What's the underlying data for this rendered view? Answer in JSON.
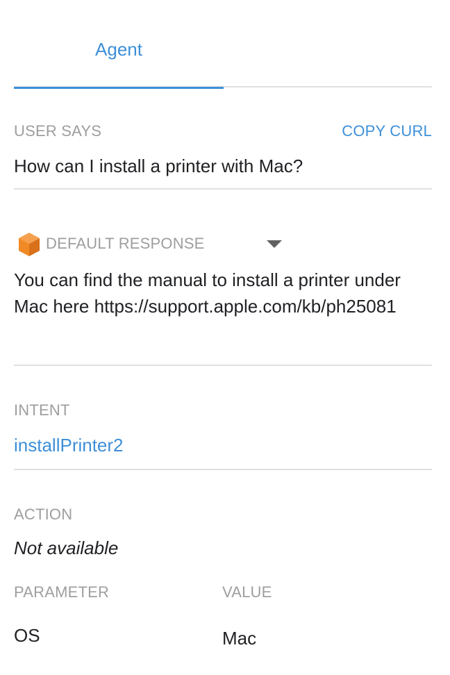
{
  "tabs": [
    {
      "label": "Agent",
      "active": true
    }
  ],
  "user_says": {
    "label": "USER SAYS",
    "copy_curl_label": "COPY CURL",
    "text": "How can I install a printer with Mac?"
  },
  "default_response": {
    "label": "DEFAULT RESPONSE",
    "icon": "orange-cube-icon",
    "line1": "You can find the manual to install a printer under",
    "line2": "Mac here https://support.apple.com/kb/ph25081"
  },
  "intent": {
    "label": "INTENT",
    "value": "installPrinter2"
  },
  "action": {
    "label": "ACTION",
    "value": "Not available"
  },
  "parameters": {
    "param_header": "PARAMETER",
    "value_header": "VALUE",
    "rows": [
      {
        "parameter": "OS",
        "value": "Mac"
      }
    ]
  },
  "colors": {
    "accent": "#3d8fd8",
    "label_gray": "#9e9e9e",
    "divider": "#e0e0e0",
    "icon_orange": "#f08a24"
  }
}
